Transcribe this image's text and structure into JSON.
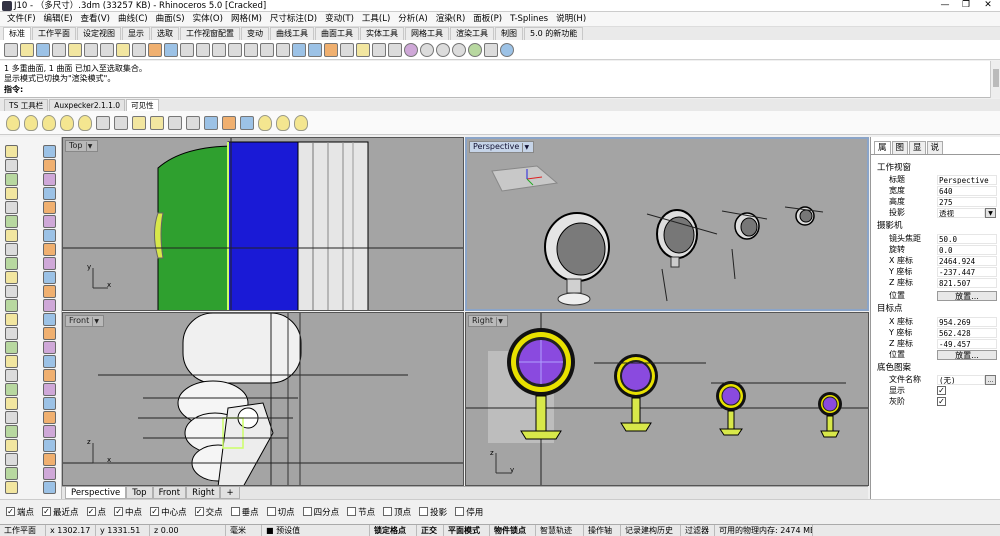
{
  "window": {
    "title": "J10 - （多尺寸）.3dm (33257 KB) - Rhinoceros 5.0 [Cracked]",
    "minimize": "—",
    "maximize": "❐",
    "close": "✕"
  },
  "menu": [
    "文件(F)",
    "编辑(E)",
    "查看(V)",
    "曲线(C)",
    "曲面(S)",
    "实体(O)",
    "网格(M)",
    "尺寸标注(D)",
    "变动(T)",
    "工具(L)",
    "分析(A)",
    "渲染(R)",
    "面板(P)",
    "T-Splines",
    "说明(H)"
  ],
  "toolbar_tabs": [
    "标准",
    "工作平面",
    "设定视图",
    "显示",
    "选取",
    "工作视窗配置",
    "变动",
    "曲线工具",
    "曲面工具",
    "实体工具",
    "网格工具",
    "渲染工具",
    "制图",
    "5.0 的新功能"
  ],
  "command_history": [
    "1 多重曲面, 1 曲面 已加入至选取集合。",
    "显示模式已切换为\"渲染模式\"。"
  ],
  "command_prompt": "指令:",
  "tool_tabs": [
    "TS 工具栏",
    "Auxpecker2.1.1.0",
    "可见性"
  ],
  "viewports": {
    "top": "Top",
    "perspective": "Perspective",
    "front": "Front",
    "right": "Right"
  },
  "axis_labels": {
    "x": "x",
    "y": "y",
    "z": "z"
  },
  "viewport_tabs": [
    "Perspective",
    "Top",
    "Front",
    "Right",
    "+"
  ],
  "osnaps": [
    {
      "label": "端点",
      "checked": true
    },
    {
      "label": "最近点",
      "checked": true
    },
    {
      "label": "点",
      "checked": true
    },
    {
      "label": "中点",
      "checked": true
    },
    {
      "label": "中心点",
      "checked": true
    },
    {
      "label": "交点",
      "checked": true
    },
    {
      "label": "垂点",
      "checked": false
    },
    {
      "label": "切点",
      "checked": false
    },
    {
      "label": "四分点",
      "checked": false
    },
    {
      "label": "节点",
      "checked": false
    },
    {
      "label": "顶点",
      "checked": false
    },
    {
      "label": "投影",
      "checked": false
    },
    {
      "label": "停用",
      "checked": false
    }
  ],
  "status_bar": [
    "工作平面",
    "x 1302.17",
    "y 1331.51",
    "z 0.00",
    "毫米",
    "■ 预设值",
    "锁定格点",
    "正交",
    "平面模式",
    "物件锁点",
    "智慧轨迹",
    "操作轴",
    "记录建构历史",
    "过滤器",
    "可用的物理内存: 2474 MB"
  ],
  "panel_tabs": [
    "属",
    "图",
    "显",
    "说"
  ],
  "properties": {
    "viewport_section": "工作视窗",
    "title_label": "标题",
    "title_value": "Perspective",
    "width_label": "宽度",
    "width_value": "640",
    "height_label": "高度",
    "height_value": "275",
    "projection_label": "投影",
    "projection_value": "透视",
    "camera_section": "摄影机",
    "lens_label": "镜头焦距",
    "lens_value": "50.0",
    "rotation_label": "旋转",
    "rotation_value": "0.0",
    "cam_x_label": "X 座标",
    "cam_x_value": "2464.924",
    "cam_y_label": "Y 座标",
    "cam_y_value": "-237.447",
    "cam_z_label": "Z 座标",
    "cam_z_value": "821.507",
    "cam_pos_label": "位置",
    "cam_pos_button": "放置...",
    "target_section": "目标点",
    "tgt_x_label": "X 座标",
    "tgt_x_value": "954.269",
    "tgt_y_label": "Y 座标",
    "tgt_y_value": "562.428",
    "tgt_z_label": "Z 座标",
    "tgt_z_value": "-49.457",
    "tgt_pos_label": "位置",
    "tgt_pos_button": "放置...",
    "wallpaper_section": "底色图案",
    "file_label": "文件名称",
    "file_value": "(无)",
    "file_button": "...",
    "show_label": "显示",
    "show_checked": true,
    "gray_label": "灰阶",
    "gray_checked": true
  },
  "colors": {
    "viewport_bg": "#a4a4a4",
    "active_border": "#8aa4c8",
    "object_green": "#2fa02f",
    "object_blue": "#1a1ad6",
    "object_yellow": "#d8e84a",
    "object_purple": "#8a4adf"
  }
}
